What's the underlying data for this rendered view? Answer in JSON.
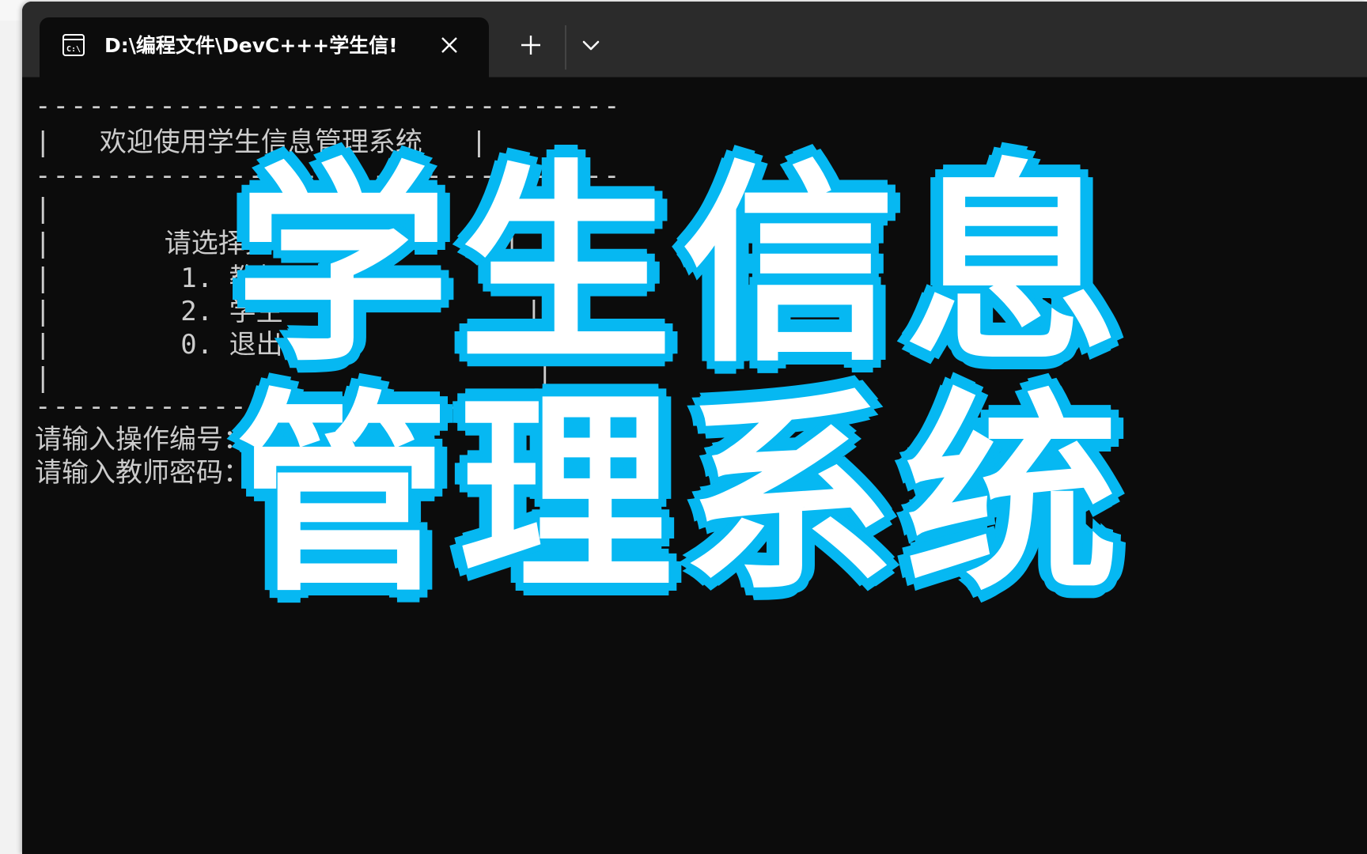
{
  "tab": {
    "title": "D:\\编程文件\\DevC+++学生信!",
    "icon": "terminal-icon",
    "close_icon": "close-icon"
  },
  "toolbar": {
    "new_tab_icon": "plus-icon",
    "dropdown_icon": "chevron-down-icon"
  },
  "terminal": {
    "lines": [
      "---------------------------------",
      "|   欢迎使用学生信息管理系统   |",
      "---------------------------------",
      "|                              |",
      "|       请选择身份：           |",
      "|        1. 教师               |",
      "|        2. 学生               |",
      "|        0. 退出               |",
      "|                              |",
      "---------------------------------",
      "请输入操作编号：1",
      "请输入教师密码："
    ]
  },
  "overlay": {
    "line1": "学生信息",
    "line2": "管理系统",
    "fill_color": "#ffffff",
    "outline_color": "#06b8f2"
  },
  "colors": {
    "terminal_bg": "#0c0c0c",
    "tabbar_bg": "#2b2b2b",
    "text": "#cccccc"
  }
}
